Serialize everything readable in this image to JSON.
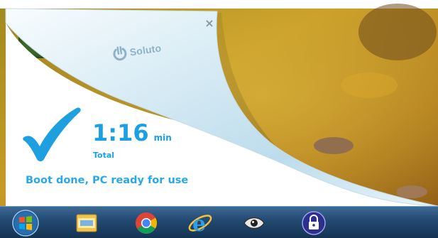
{
  "notification": {
    "brand": "Soluto",
    "close_label": "×",
    "boot_time_value": "1:16",
    "boot_time_unit": "min",
    "boot_time_label": "Total",
    "status_message": "Boot done, PC ready for use"
  },
  "colors": {
    "accent": "#1ba1e2",
    "logo": "#8fb2c6",
    "taskbar": "#244b73"
  },
  "taskbar": {
    "items": [
      {
        "icon": "start-orb-icon"
      },
      {
        "icon": "file-explorer-icon"
      },
      {
        "icon": "chrome-icon"
      },
      {
        "icon": "internet-explorer-icon"
      },
      {
        "icon": "eye-app-icon"
      },
      {
        "icon": "lock-app-icon"
      }
    ]
  }
}
